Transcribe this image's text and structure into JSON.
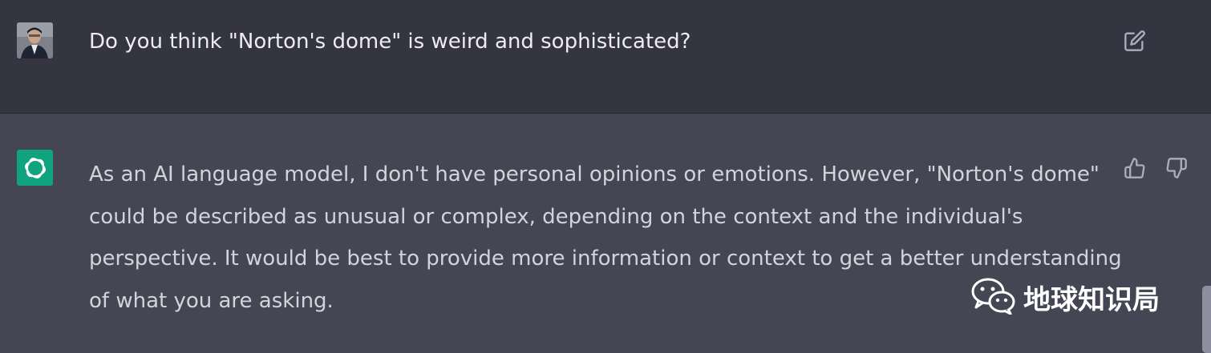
{
  "user_message": {
    "text": "Do you think \"Norton's dome\" is weird and sophisticated?"
  },
  "assistant_message": {
    "text": "As an AI language model, I don't have personal opinions or emotions. However, \"Norton's dome\" could be described as unusual or complex, depending on the context and the individual's perspective. It would be best to provide more information or context to get a better understanding of what you are asking."
  },
  "icons": {
    "edit": "edit-icon",
    "thumbs_up": "thumbs-up-icon",
    "thumbs_down": "thumbs-down-icon",
    "assistant_logo": "openai-logo-icon",
    "wechat": "wechat-icon"
  },
  "watermark": {
    "text": "地球知识局"
  },
  "colors": {
    "user_bg": "#343541",
    "assistant_bg": "#444654",
    "accent": "#10a37f",
    "text": "#d1d5db"
  }
}
